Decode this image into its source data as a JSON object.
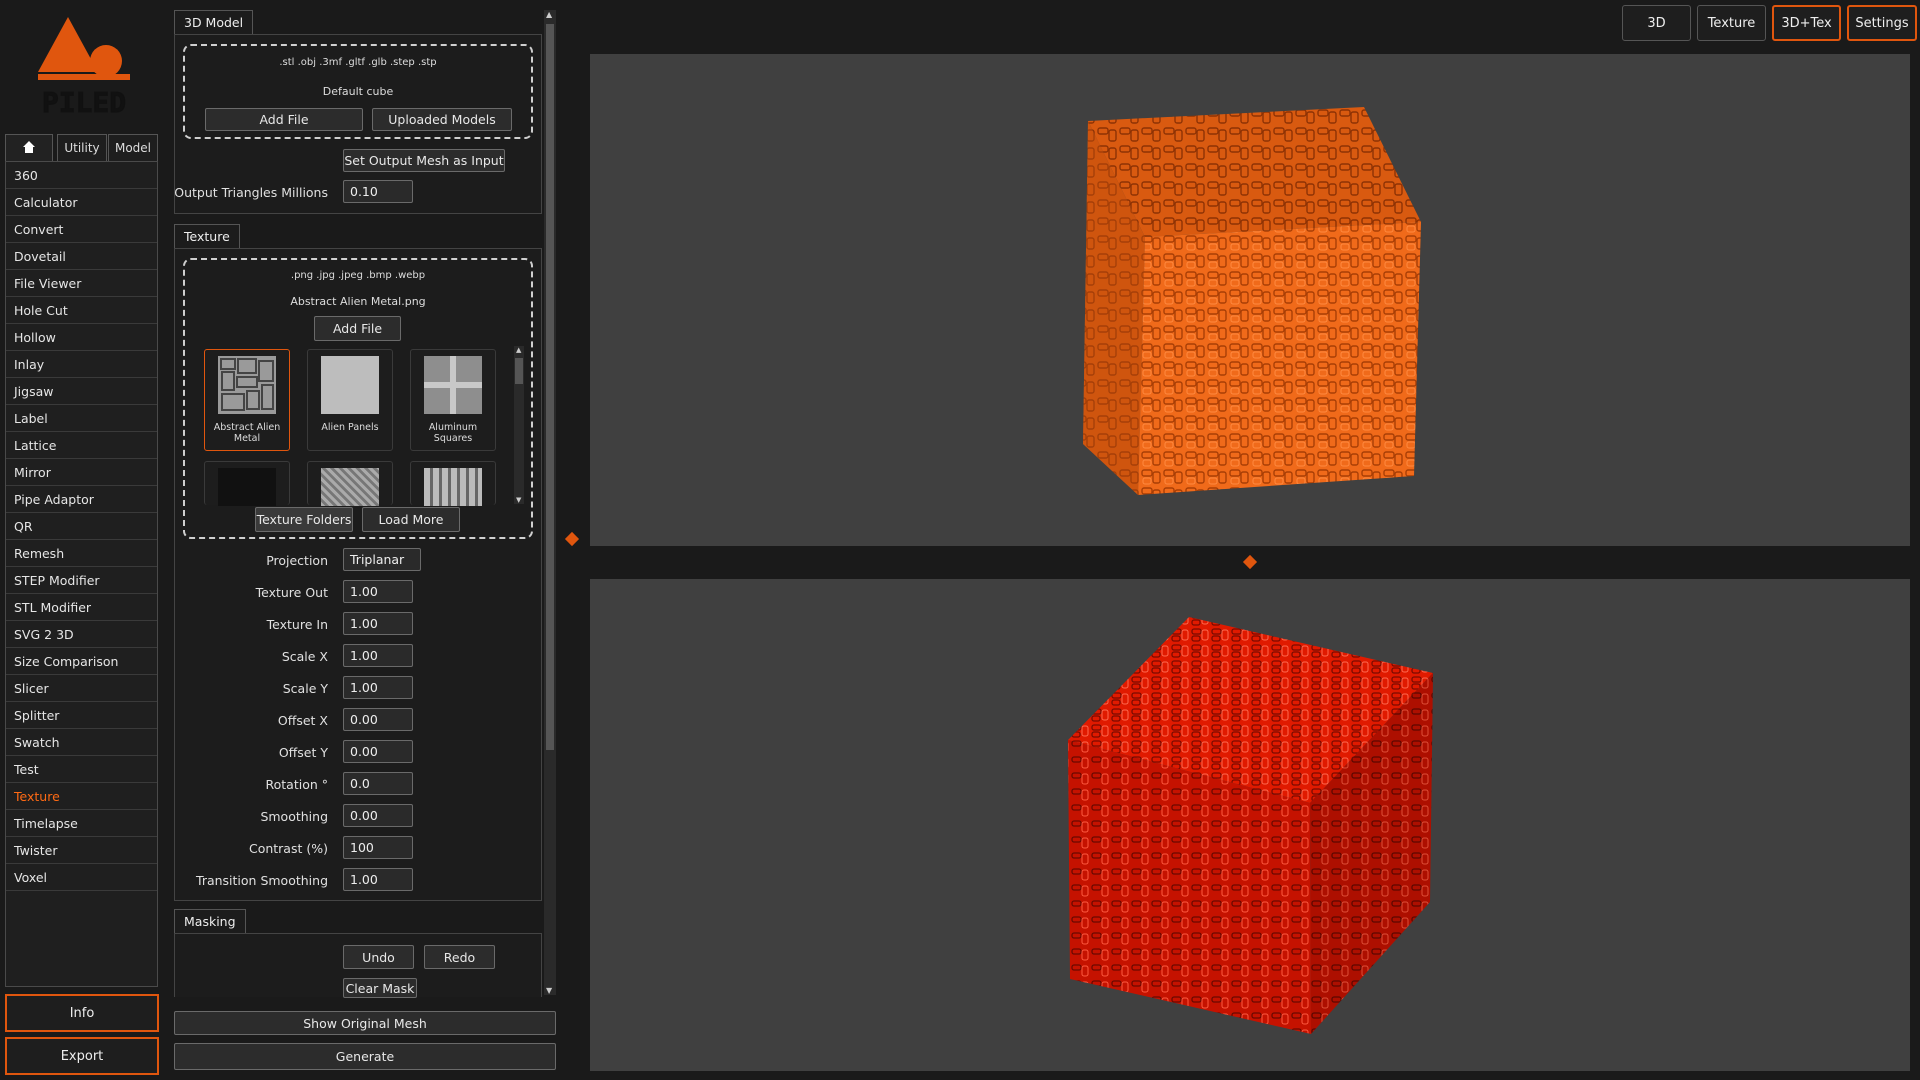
{
  "app": {
    "logo_text": "PILED"
  },
  "sidebar": {
    "tabs": [
      {
        "icon": "home-icon"
      },
      {
        "label": "Utility"
      },
      {
        "label": "Model"
      }
    ],
    "items": [
      "360",
      "Calculator",
      "Convert",
      "Dovetail",
      "File Viewer",
      "Hole Cut",
      "Hollow",
      "Inlay",
      "Jigsaw",
      "Label",
      "Lattice",
      "Mirror",
      "Pipe Adaptor",
      "QR",
      "Remesh",
      "STEP Modifier",
      "STL Modifier",
      "SVG 2 3D",
      "Size Comparison",
      "Slicer",
      "Splitter",
      "Swatch",
      "Test",
      "Texture",
      "Timelapse",
      "Twister",
      "Voxel"
    ],
    "active_item": "Texture",
    "info_label": "Info",
    "export_label": "Export"
  },
  "model_panel": {
    "tab": "3D Model",
    "formats": ".stl .obj .3mf .gltf .glb .step .stp",
    "current_file": "Default cube",
    "add_file": "Add File",
    "uploaded_models": "Uploaded Models",
    "set_output": "Set Output Mesh as Input",
    "triangles_label": "Output Triangles Millions",
    "triangles_value": "0.10"
  },
  "texture_panel": {
    "tab": "Texture",
    "formats": ".png .jpg .jpeg .bmp .webp",
    "current_file": "Abstract Alien Metal.png",
    "add_file": "Add File",
    "thumbnails": [
      {
        "name": "Abstract Alien Metal",
        "selected": true
      },
      {
        "name": "Alien Panels"
      },
      {
        "name": "Aluminum Squares"
      }
    ],
    "texture_folders": "Texture Folders",
    "load_more": "Load More",
    "params": {
      "projection": {
        "label": "Projection",
        "value": "Triplanar"
      },
      "texture_out": {
        "label": "Texture Out",
        "value": "1.00"
      },
      "texture_in": {
        "label": "Texture In",
        "value": "1.00"
      },
      "scale_x": {
        "label": "Scale X",
        "value": "1.00"
      },
      "scale_y": {
        "label": "Scale Y",
        "value": "1.00"
      },
      "offset_x": {
        "label": "Offset X",
        "value": "0.00"
      },
      "offset_y": {
        "label": "Offset Y",
        "value": "0.00"
      },
      "rotation": {
        "label": "Rotation °",
        "value": "0.0"
      },
      "smoothing": {
        "label": "Smoothing",
        "value": "0.00"
      },
      "contrast": {
        "label": "Contrast (%)",
        "value": "100"
      },
      "transition": {
        "label": "Transition Smoothing",
        "value": "1.00"
      }
    }
  },
  "masking_panel": {
    "tab": "Masking",
    "undo": "Undo",
    "redo": "Redo",
    "clear_mask": "Clear Mask"
  },
  "bottom": {
    "show_original": "Show Original Mesh",
    "generate": "Generate"
  },
  "top_bar": {
    "buttons": [
      {
        "label": "3D",
        "active": false
      },
      {
        "label": "Texture",
        "active": false
      },
      {
        "label": "3D+Tex",
        "active": true
      },
      {
        "label": "Settings",
        "active": true
      }
    ]
  },
  "colors": {
    "accent": "#e0560e",
    "cube_top": "#ff6a14",
    "cube_bottom": "#e01a00",
    "viewport_bg": "#404040"
  }
}
